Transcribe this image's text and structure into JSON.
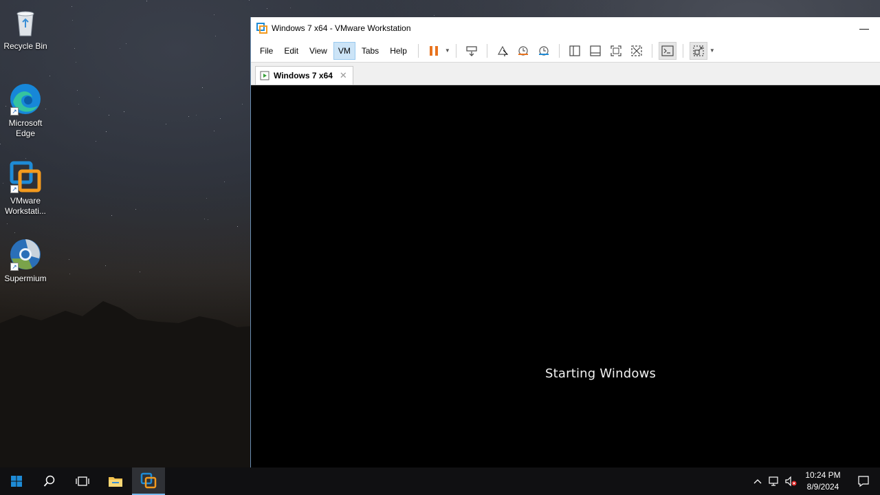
{
  "desktop": {
    "icons": [
      {
        "label": "Recycle Bin",
        "icon": "recycle-bin-icon"
      },
      {
        "label": "Microsoft Edge",
        "icon": "edge-icon"
      },
      {
        "label": "VMware Workstati...",
        "icon": "vmware-icon"
      },
      {
        "label": "Supermium",
        "icon": "supermium-icon"
      }
    ]
  },
  "window": {
    "title": "Windows 7 x64 - VMware Workstation",
    "minimize_glyph": "—",
    "menu": [
      "File",
      "Edit",
      "View",
      "VM",
      "Tabs",
      "Help"
    ],
    "active_menu": "VM",
    "tab": {
      "label": "Windows 7 x64",
      "close_glyph": "✕"
    },
    "vm_status": "Starting Windows"
  },
  "taskbar": {
    "time": "10:24 PM",
    "date": "8/9/2024"
  },
  "colors": {
    "accent": "#76b9ed",
    "pause_orange": "#e8731e",
    "vmware_blue": "#1e8bd6"
  }
}
